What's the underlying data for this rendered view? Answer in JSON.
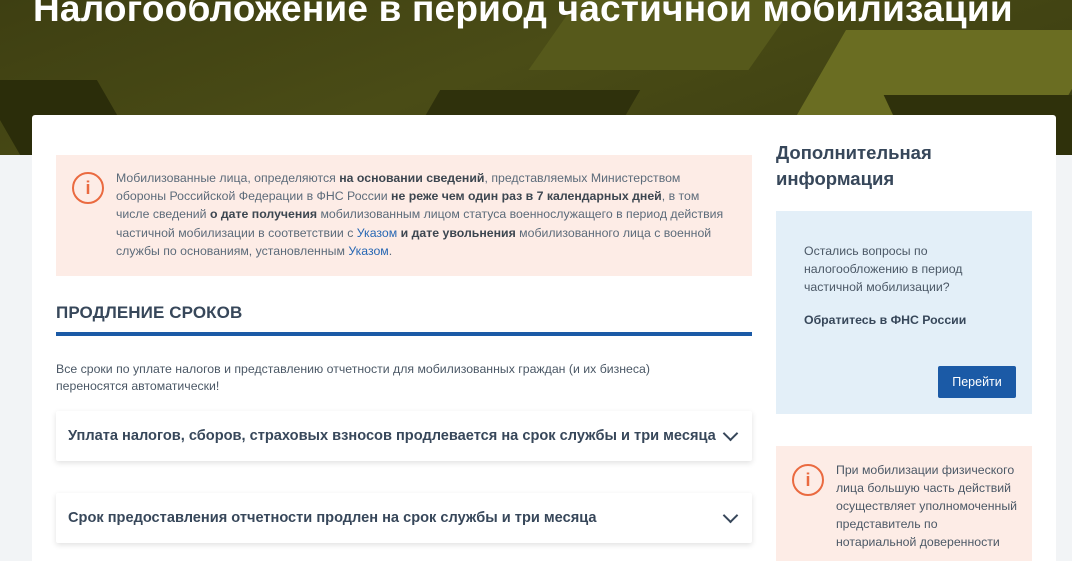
{
  "hero": {
    "title": "Налогообложение в период частичной мобилизации"
  },
  "info": {
    "icon": "info-icon",
    "parts": [
      "Мобилизованные лица, определяются ",
      "на основании сведений",
      ", представляемых Министерством обороны Российской Федерации в ФНС России ",
      "не реже чем один раз в 7 календарных дней",
      ", в том числе сведений ",
      "о дате получения",
      " мобилизованным лицом статуса военнослужащего в период действия частичной мобилизации в соответствии с ",
      "Указом",
      " ",
      "и дате увольнения",
      " мобилизованного лица с военной службы по основаниям, установленным ",
      "Указом",
      "."
    ]
  },
  "section": {
    "title": "ПРОДЛЕНИЕ СРОКОВ",
    "lead": "Все сроки по уплате налогов и представлению отчетности для мобилизованных граждан (и их бизнеса) переносятся автоматически!"
  },
  "accordion": [
    {
      "label": "Уплата налогов, сборов, страховых взносов продлевается на срок службы и три месяца"
    },
    {
      "label": "Срок предоставления отчетности продлен на срок службы и три месяца"
    }
  ],
  "sidebar": {
    "title": "Дополнительная информация",
    "question": "Остались вопросы по налогообложению в период частичной мобилизации?",
    "cta": "Обратитесь в ФНС России",
    "button": "Перейти",
    "warning": "При мобилизации физического лица большую часть действий осуществляет уполномоченный представитель по нотариальной доверенности"
  },
  "colors": {
    "accent": "#1b5aa6",
    "warning": "#ea6a40",
    "hero": "#4a4c16"
  }
}
